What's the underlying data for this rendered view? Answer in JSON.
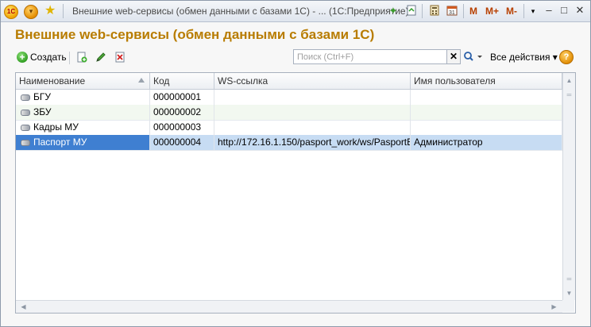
{
  "window": {
    "title": "Внешние web-сервисы (обмен данными с базами 1С) - ...  (1С:Предприятие)",
    "logo_text": "1С",
    "m_buttons": [
      "M",
      "M+",
      "M-"
    ],
    "controls": {
      "minimize": "–",
      "maximize": "□",
      "close": "✕"
    }
  },
  "page": {
    "title": "Внешние web-сервисы (обмен данными с базами 1С)"
  },
  "toolbar": {
    "create_label": "Создать",
    "search_placeholder": "Поиск (Ctrl+F)",
    "search_clear": "✕",
    "all_actions_label": "Все действия ▾",
    "help": "?"
  },
  "table": {
    "columns": [
      "Наименование",
      "Код",
      "WS-ссылка",
      "Имя пользователя"
    ],
    "rows": [
      {
        "name": "БГУ",
        "code": "000000001",
        "ws": "",
        "user": ""
      },
      {
        "name": "ЗБУ",
        "code": "000000002",
        "ws": "",
        "user": ""
      },
      {
        "name": "Кадры МУ",
        "code": "000000003",
        "ws": "",
        "user": ""
      },
      {
        "name": "Паспорт МУ",
        "code": "000000004",
        "ws": "http://172.16.1.150/pasport_work/ws/PasportE...",
        "user": "Администратор"
      }
    ],
    "selected_row": 3
  },
  "colors": {
    "accent_title": "#b87c00",
    "selected_row": "#c7dcf3",
    "selected_cell": "#3f7fd1"
  }
}
